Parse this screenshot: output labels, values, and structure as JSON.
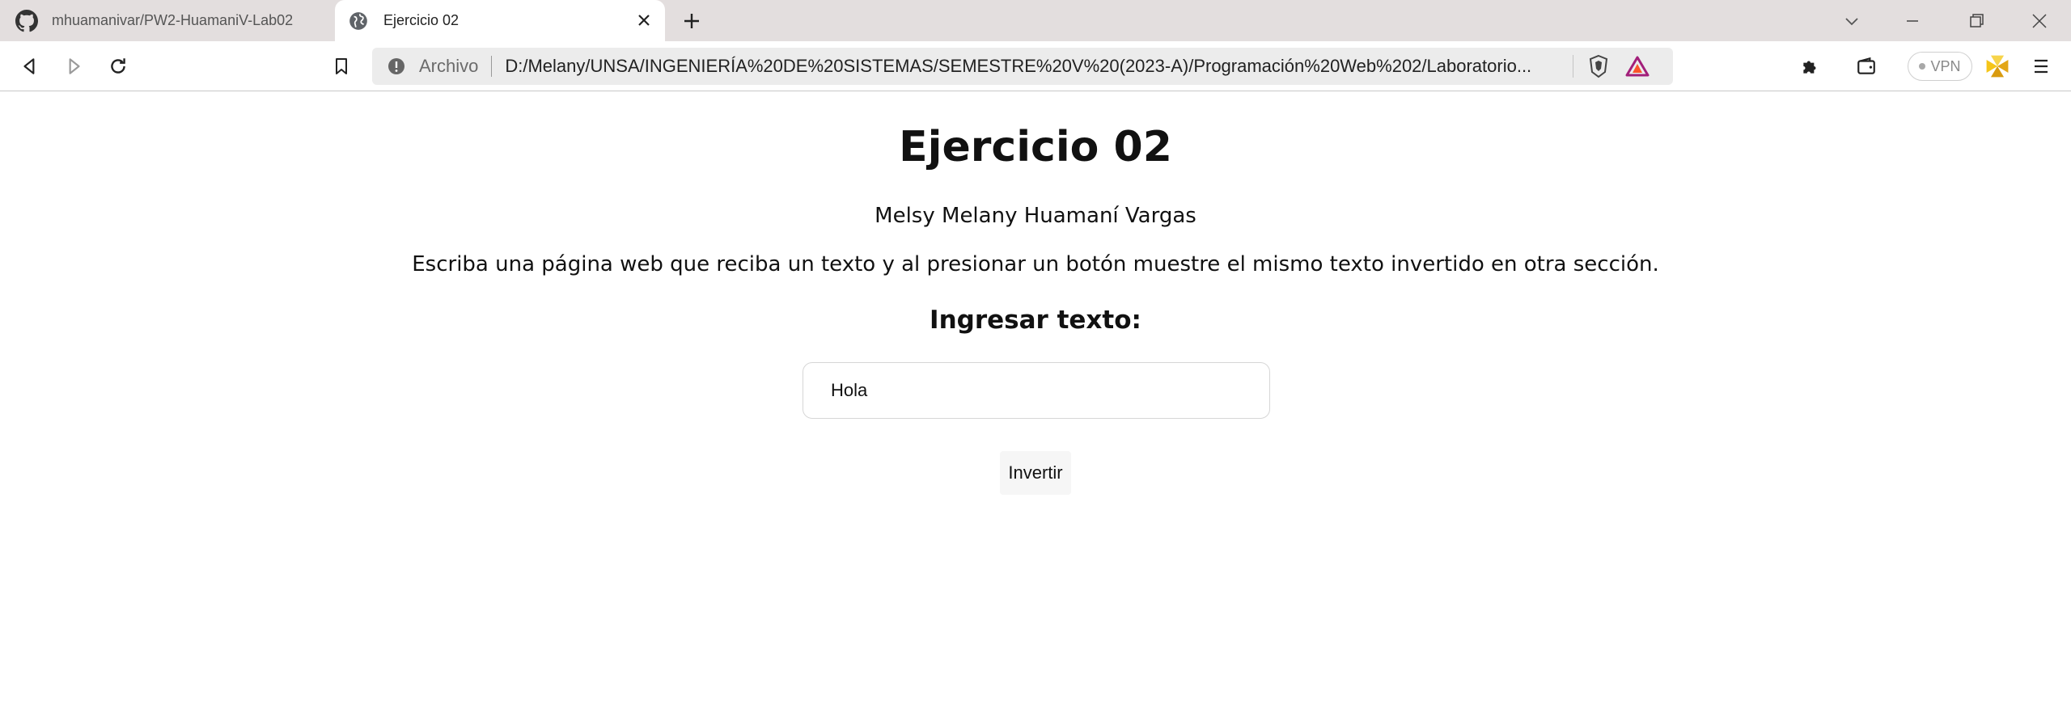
{
  "tabs": [
    {
      "title": "mhuamanivar/PW2-HuamaniV-Lab02",
      "icon": "github-icon",
      "active": false
    },
    {
      "title": "Ejercicio 02",
      "icon": "globe-icon",
      "active": true
    }
  ],
  "toolbar": {
    "scheme_label": "Archivo",
    "url": "D:/Melany/UNSA/INGENIERÍA%20DE%20SISTEMAS/SEMESTRE%20V%20(2023-A)/Programación%20Web%202/Laboratorio...",
    "vpn_label": "VPN"
  },
  "page": {
    "title": "Ejercicio 02",
    "author": "Melsy Melany Huamaní Vargas",
    "description": "Escriba una página web que reciba un texto y al presionar un botón muestre el mismo texto invertido en otra sección.",
    "input_label": "Ingresar texto:",
    "input_value": "Hola",
    "button_label": "Invertir",
    "result": ""
  },
  "colors": {
    "tabstrip_bg": "#e3dede",
    "omnibox_bg": "#ececec",
    "brave_shield": "#fb542b",
    "bat_triangle": "#a21f7a"
  }
}
